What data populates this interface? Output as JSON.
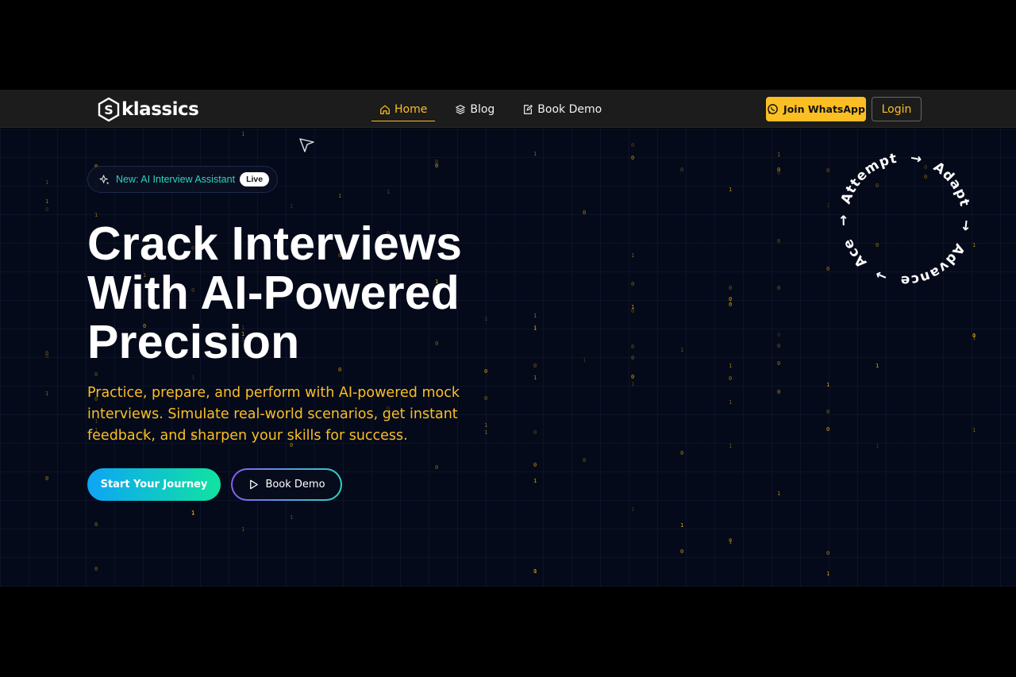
{
  "brand": {
    "logo_letter": "S",
    "name": "klassics",
    "accent": "#fbbf24"
  },
  "nav": {
    "items": [
      {
        "label": "Home",
        "icon": "home-icon",
        "active": true
      },
      {
        "label": "Blog",
        "icon": "layers-icon",
        "active": false
      },
      {
        "label": "Book Demo",
        "icon": "edit-icon",
        "active": false
      }
    ],
    "whatsapp_label": "Join WhatsApp",
    "login_label": "Login"
  },
  "hero": {
    "badge_text": "New: AI Interview Assistant",
    "badge_status": "Live",
    "headline": [
      "Crack Interviews",
      "With AI-Powered",
      "Precision"
    ],
    "subtext": "Practice, prepare, and perform with AI-powered mock interviews. Simulate real-world scenarios, get instant feedback, and sharpen your skills for success.",
    "primary_cta": "Start Your Journey",
    "secondary_cta": "Book Demo"
  },
  "cycle": {
    "steps": [
      "Attempt",
      "Adapt",
      "Advance",
      "Ace"
    ],
    "arrow": "→"
  },
  "colors": {
    "hero_bg": "#050a1a",
    "matrix_digit": "#e0a80b",
    "badge_text": "#2dd4bf",
    "cta_gradient_start": "#0ea5f5",
    "cta_gradient_end": "#10e3a0"
  }
}
